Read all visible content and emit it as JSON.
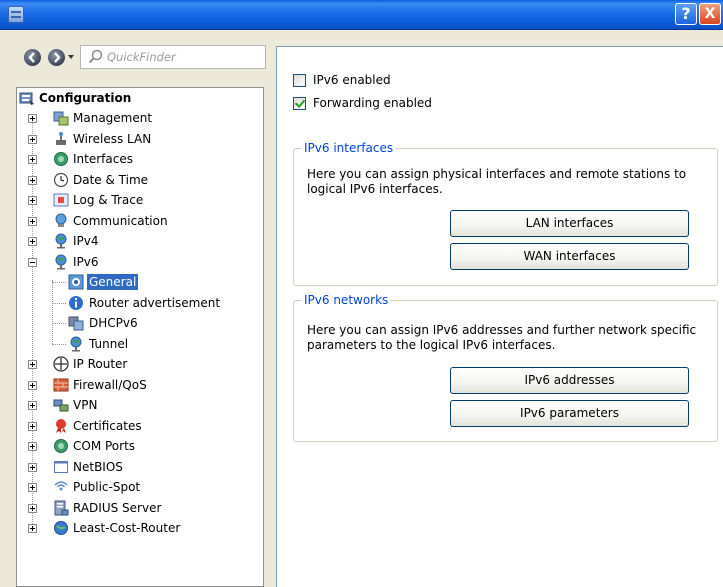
{
  "titlebar": {
    "help_label": "?",
    "close_label": "X"
  },
  "nav": {
    "quickfinder_placeholder": "QuickFinder"
  },
  "tree": {
    "root": "Configuration",
    "items": [
      "Management",
      "Wireless LAN",
      "Interfaces",
      "Date & Time",
      "Log & Trace",
      "Communication",
      "IPv4",
      "IPv6",
      "IP Router",
      "Firewall/QoS",
      "VPN",
      "Certificates",
      "COM Ports",
      "NetBIOS",
      "Public-Spot",
      "RADIUS Server",
      "Least-Cost-Router"
    ],
    "ipv6_children": [
      "General",
      "Router advertisement",
      "DHCPv6",
      "Tunnel"
    ],
    "selected": "General"
  },
  "settings": {
    "ipv6_enabled_label": "IPv6 enabled",
    "ipv6_enabled": false,
    "forwarding_enabled_label": "Forwarding enabled",
    "forwarding_enabled": true
  },
  "ipv6_interfaces": {
    "title": "IPv6 interfaces",
    "description": "Here you can assign physical interfaces and remote stations to logical IPv6 interfaces.",
    "buttons": [
      "LAN interfaces",
      "WAN interfaces"
    ]
  },
  "ipv6_networks": {
    "title": "IPv6 networks",
    "description": "Here you can assign IPv6 addresses and further network specific parameters to the logical IPv6 interfaces.",
    "buttons": [
      "IPv6 addresses",
      "IPv6 parameters"
    ]
  },
  "colors": {
    "titlebar": "#0f5fdc",
    "selection": "#316ac5",
    "group_title": "#0046d5",
    "window_bg": "#ece9d8"
  }
}
